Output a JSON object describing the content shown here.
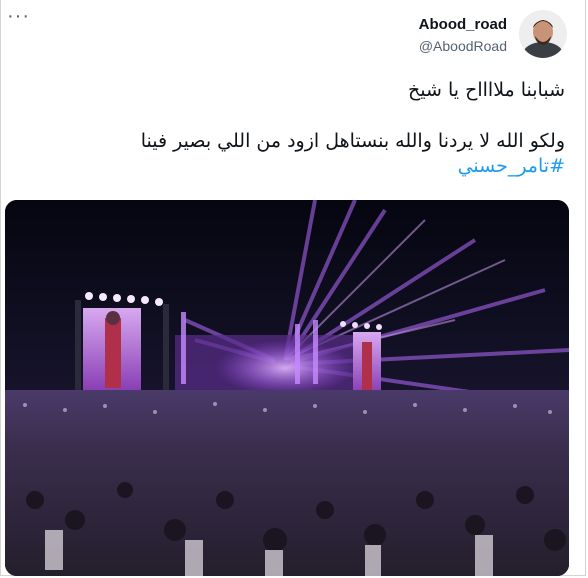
{
  "tweet": {
    "display_name": "Abood_road",
    "handle": "@AboodRoad",
    "more_label": "···",
    "text_line1": "شبابنا ملااااح يا شيخ",
    "text_line2": "ولكو الله لا يردنا والله بنستاهل ازود من اللي بصير فينا",
    "hashtag": "#تامر_حسني"
  },
  "icons": {
    "more": "more-options-icon",
    "avatar": "user-avatar-photo"
  },
  "colors": {
    "text": "#0f1419",
    "secondary": "#536471",
    "link": "#1d9bf0",
    "concert_purple": "#a64dff"
  }
}
